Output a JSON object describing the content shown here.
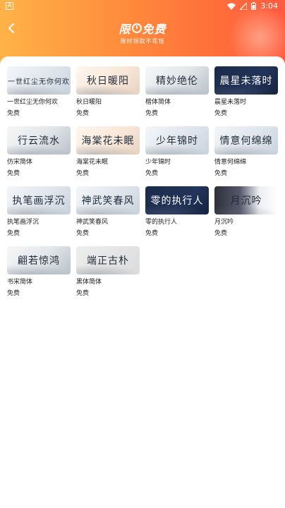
{
  "status_bar": {
    "app_icon_letter": "A",
    "time": "3:04"
  },
  "header": {
    "title_part1": "限",
    "title_part2": "免费",
    "subtitle": "限时领取不花钱",
    "back_icon": "chevron-left-icon"
  },
  "fonts": [
    {
      "preview": "一世红尘无你何欢",
      "name": "一世红尘无你何欢",
      "price": "免费",
      "style": "light",
      "small": true
    },
    {
      "preview": "秋日暖阳",
      "name": "秋日暖阳",
      "price": "免费",
      "style": "warm",
      "small": false
    },
    {
      "preview": "精妙绝伦",
      "name": "楷体简体",
      "price": "免费",
      "style": "mist",
      "small": false
    },
    {
      "preview": "晨星未落时",
      "name": "晨星未落时",
      "price": "免费",
      "style": "dark",
      "small": false
    },
    {
      "preview": "行云流水",
      "name": "仿宋简体",
      "price": "免费",
      "style": "mist",
      "small": false
    },
    {
      "preview": "海棠花未眠",
      "name": "海棠花未眠",
      "price": "免费",
      "style": "warm",
      "small": false
    },
    {
      "preview": "少年锦时",
      "name": "少年锦时",
      "price": "免费",
      "style": "light",
      "small": false
    },
    {
      "preview": "情意何绵绵",
      "name": "情意何绵绵",
      "price": "免费",
      "style": "light",
      "small": false
    },
    {
      "preview": "执笔画浮沉",
      "name": "执笔画浮沉",
      "price": "免费",
      "style": "light",
      "small": false
    },
    {
      "preview": "神武笑春风",
      "name": "神武笑春风",
      "price": "免费",
      "style": "light",
      "small": false
    },
    {
      "preview": "零的执行人",
      "name": "零的执行人",
      "price": "免费",
      "style": "dark",
      "small": false
    },
    {
      "preview": "月沉吟",
      "name": "月沉吟",
      "price": "免费",
      "style": "moon",
      "small": false
    },
    {
      "preview": "翩若惊鸿",
      "name": "书宋简体",
      "price": "免费",
      "style": "mist",
      "small": false
    },
    {
      "preview": "端正古朴",
      "name": "黑体简体",
      "price": "免费",
      "style": "gray",
      "small": false
    }
  ],
  "colors": {
    "header_start": "#ffb347",
    "header_end": "#ff5b3f",
    "dark_card": "#1b2a4a"
  }
}
